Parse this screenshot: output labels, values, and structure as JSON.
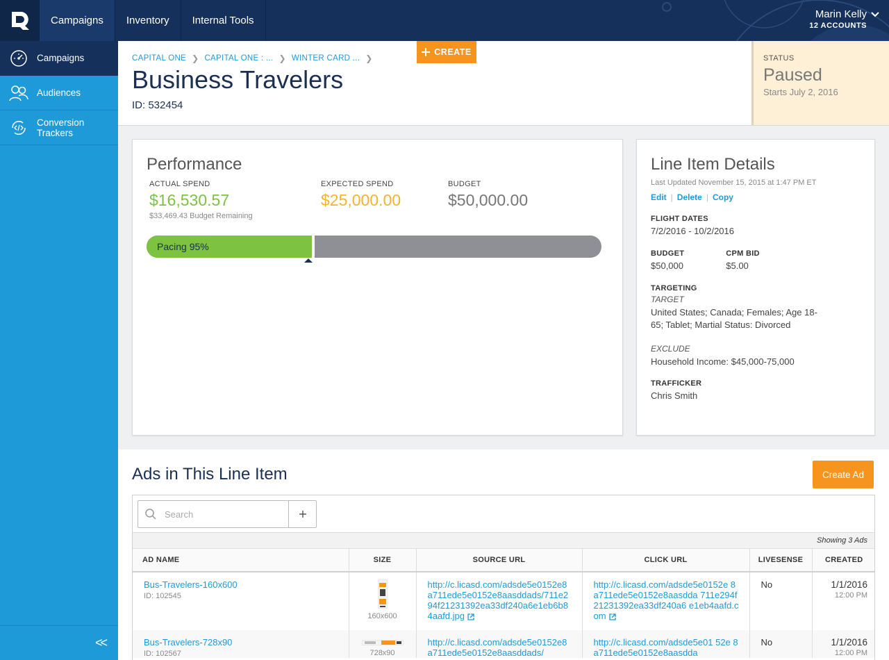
{
  "nav": {
    "tabs": [
      {
        "label": "Campaigns",
        "active": true
      },
      {
        "label": "Inventory",
        "active": false
      },
      {
        "label": "Internal Tools",
        "active": false
      }
    ],
    "user": {
      "name": "Marin Kelly",
      "accounts": "12 ACCOUNTS"
    }
  },
  "sidebar": {
    "items": [
      {
        "label": "Campaigns",
        "icon": "gauge-icon",
        "active": true
      },
      {
        "label": "Audiences",
        "icon": "audience-icon",
        "active": false
      },
      {
        "label": "Conversion Trackers",
        "icon": "code-sync-icon",
        "active": false
      }
    ],
    "collapse": "<<"
  },
  "header": {
    "breadcrumbs": [
      "CAPITAL ONE",
      "CAPITAL ONE : ...",
      "WINTER CARD ..."
    ],
    "title": "Business Travelers",
    "id_text": "ID: 532454",
    "create_label": "CREATE",
    "status": {
      "label": "STATUS",
      "value": "Paused",
      "sub": "Starts July 2, 2016"
    }
  },
  "performance": {
    "title": "Performance",
    "actual": {
      "label": "ACTUAL SPEND",
      "value": "$16,530.57",
      "sub": "$33,469.43 Budget Remaining"
    },
    "expected": {
      "label": "EXPECTED SPEND",
      "value": "$25,000.00"
    },
    "budget": {
      "label": "BUDGET",
      "value": "$50,000.00"
    },
    "pacing_label": "Pacing 95%",
    "pacing": {
      "actual_fraction": 0.3306,
      "expected_fraction": 0.5,
      "budget": 50000
    },
    "colors": {
      "actual": "#7dc241",
      "expected": "#f5b42d",
      "budget": "#777777"
    }
  },
  "details": {
    "title": "Line Item Details",
    "updated": "Last Updated November 15, 2015 at 1:47 PM ET",
    "actions": [
      "Edit",
      "Delete",
      "Copy"
    ],
    "flight_label": "FLIGHT DATES",
    "flight_value": "7/2/2016 - 10/2/2016",
    "budget_label": "BUDGET",
    "budget_value": "$50,000",
    "cpm_label": "CPM BID",
    "cpm_value": "$5.00",
    "targeting_label": "TARGETING",
    "target_label": "TARGET",
    "target_value": "United States; Canada; Females; Age 18-65; Tablet; Martial Status: Divorced",
    "exclude_label": "EXCLUDE",
    "exclude_value": "Household Income: $45,000-75,000",
    "trafficker_label": "TRAFFICKER",
    "trafficker_value": "Chris Smith"
  },
  "ads": {
    "title": "Ads in This Line Item",
    "create_label": "Create Ad",
    "search_placeholder": "Search",
    "showing": "Showing 3 Ads",
    "columns": [
      "AD NAME",
      "SIZE",
      "SOURCE URL",
      "CLICK URL",
      "LIVESENSE",
      "CREATED"
    ],
    "rows": [
      {
        "name": "Bus-Travelers-160x600",
        "id": "ID: 102545",
        "size": "160x600",
        "source_url": "http://c.licasd.com/adsde5e0152e8a711ede5e0152e8aasddads/711e294f21231392ea33df240a6e1eb6b84aafd.jpg",
        "click_url": "http://c.licasd.com/adsde5e0152e 8a711ede5e0152e8aasdda 711e294f21231392ea33df240a6 e1eb4aafd.com",
        "livesense": "No",
        "created_date": "1/1/2016",
        "created_time": "12:00 PM"
      },
      {
        "name": "Bus-Travelers-728x90",
        "id": "ID: 102567",
        "size": "728x90",
        "source_url": "http://c.licasd.com/adsde5e0152e8a711ede5e0152e8aasddads/",
        "click_url": "http://c.licasd.com/adsde5e01 52e 8a711ede5e0152e8aasdda",
        "livesense": "No",
        "created_date": "1/1/2016",
        "created_time": "12:00 PM"
      }
    ]
  }
}
